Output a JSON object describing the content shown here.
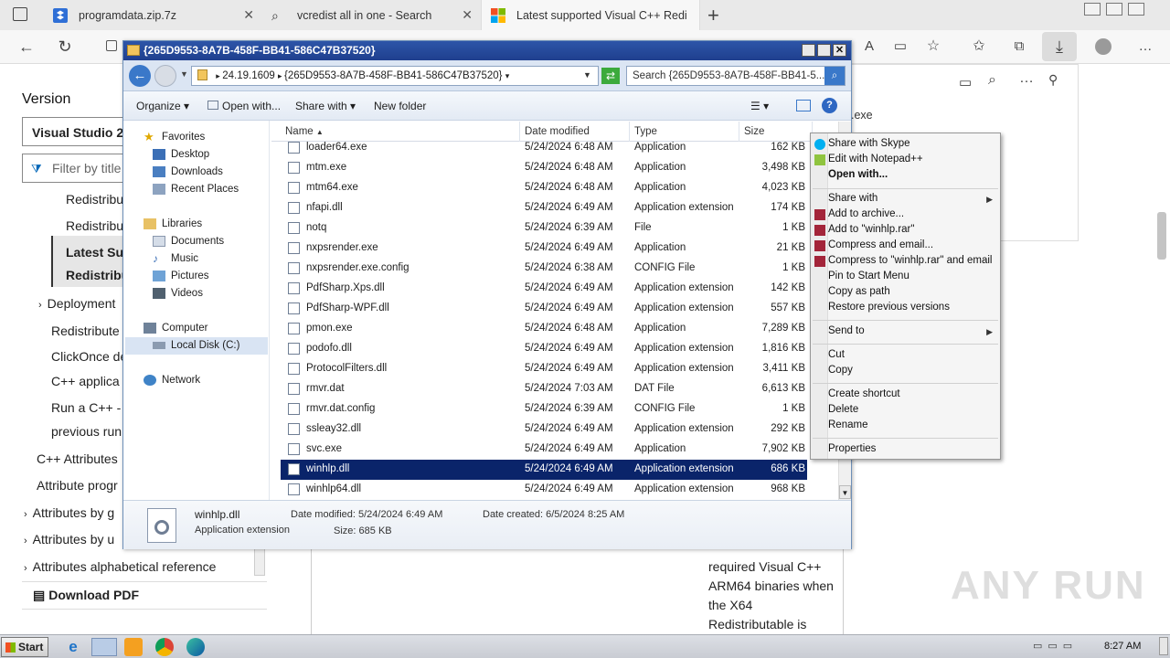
{
  "browser": {
    "tabs": [
      {
        "title": "programdata.zip.7z"
      },
      {
        "title": "vcredist all in one - Search"
      },
      {
        "title": "Latest supported Visual C++ Redi"
      }
    ],
    "new_tab": "+"
  },
  "doc": {
    "version_label": "Version",
    "version_select": "Visual Studio 20",
    "filter_placeholder": "Filter by title",
    "toc": [
      "Redistribu",
      "Redistribu",
      "Latest Sup",
      "Redistribu",
      "Deployment",
      "Redistribute",
      "ClickOnce de",
      "C++ applica",
      "Run a C++ -",
      "previous run",
      "C++ Attributes",
      "Attribute progr",
      "Attributes by g",
      "Attributes by u",
      "Attributes alphabetical reference"
    ],
    "download_pdf": "Download PDF",
    "content_snippet": ".exe",
    "content_lines": [
      "required Visual C++",
      "ARM64 binaries when",
      "the X64",
      "Redistributable is"
    ]
  },
  "explorer": {
    "title": "{265D9553-8A7B-458F-BB41-586C47B37520}",
    "breadcrumb": [
      "24.19.1609",
      "{265D9553-8A7B-458F-BB41-586C47B37520}"
    ],
    "search_placeholder": "Search {265D9553-8A7B-458F-BB41-5...",
    "toolbar": {
      "organize": "Organize",
      "open_with": "Open with...",
      "share_with": "Share with",
      "new_folder": "New folder"
    },
    "nav": {
      "favorites": "Favorites",
      "desktop": "Desktop",
      "downloads": "Downloads",
      "recent": "Recent Places",
      "libraries": "Libraries",
      "documents": "Documents",
      "music": "Music",
      "pictures": "Pictures",
      "videos": "Videos",
      "computer": "Computer",
      "local_disk": "Local Disk (C:)",
      "network": "Network"
    },
    "columns": [
      "Name",
      "Date modified",
      "Type",
      "Size"
    ],
    "files": [
      {
        "name": "loader64.exe",
        "date": "5/24/2024 6:48 AM",
        "type": "Application",
        "size": "162 KB"
      },
      {
        "name": "mtm.exe",
        "date": "5/24/2024 6:48 AM",
        "type": "Application",
        "size": "3,498 KB"
      },
      {
        "name": "mtm64.exe",
        "date": "5/24/2024 6:48 AM",
        "type": "Application",
        "size": "4,023 KB"
      },
      {
        "name": "nfapi.dll",
        "date": "5/24/2024 6:49 AM",
        "type": "Application extension",
        "size": "174 KB"
      },
      {
        "name": "notq",
        "date": "5/24/2024 6:39 AM",
        "type": "File",
        "size": "1 KB"
      },
      {
        "name": "nxpsrender.exe",
        "date": "5/24/2024 6:49 AM",
        "type": "Application",
        "size": "21 KB"
      },
      {
        "name": "nxpsrender.exe.config",
        "date": "5/24/2024 6:38 AM",
        "type": "CONFIG File",
        "size": "1 KB"
      },
      {
        "name": "PdfSharp.Xps.dll",
        "date": "5/24/2024 6:49 AM",
        "type": "Application extension",
        "size": "142 KB"
      },
      {
        "name": "PdfSharp-WPF.dll",
        "date": "5/24/2024 6:49 AM",
        "type": "Application extension",
        "size": "557 KB"
      },
      {
        "name": "pmon.exe",
        "date": "5/24/2024 6:48 AM",
        "type": "Application",
        "size": "7,289 KB"
      },
      {
        "name": "podofo.dll",
        "date": "5/24/2024 6:49 AM",
        "type": "Application extension",
        "size": "1,816 KB"
      },
      {
        "name": "ProtocolFilters.dll",
        "date": "5/24/2024 6:49 AM",
        "type": "Application extension",
        "size": "3,411 KB"
      },
      {
        "name": "rmvr.dat",
        "date": "5/24/2024 7:03 AM",
        "type": "DAT File",
        "size": "6,613 KB"
      },
      {
        "name": "rmvr.dat.config",
        "date": "5/24/2024 6:39 AM",
        "type": "CONFIG File",
        "size": "1 KB"
      },
      {
        "name": "ssleay32.dll",
        "date": "5/24/2024 6:49 AM",
        "type": "Application extension",
        "size": "292 KB"
      },
      {
        "name": "svc.exe",
        "date": "5/24/2024 6:49 AM",
        "type": "Application",
        "size": "7,902 KB"
      },
      {
        "name": "winhlp.dll",
        "date": "5/24/2024 6:49 AM",
        "type": "Application extension",
        "size": "686 KB"
      },
      {
        "name": "winhlp64.dll",
        "date": "5/24/2024 6:49 AM",
        "type": "Application extension",
        "size": "968 KB"
      }
    ],
    "selected_file": "winhlp.dll",
    "details": {
      "name": "winhlp.dll",
      "type": "Application extension",
      "modified_label": "Date modified:",
      "modified": "5/24/2024 6:49 AM",
      "created_label": "Date created:",
      "created": "6/5/2024 8:25 AM",
      "size_label": "Size:",
      "size": "685 KB"
    }
  },
  "context_menu": {
    "items": [
      "Share with Skype",
      "Edit with Notepad++",
      "Open with...",
      "Share with",
      "Add to archive...",
      "Add to \"winhlp.rar\"",
      "Compress and email...",
      "Compress to \"winhlp.rar\" and email",
      "Pin to Start Menu",
      "Copy as path",
      "Restore previous versions",
      "Send to",
      "Cut",
      "Copy",
      "Create shortcut",
      "Delete",
      "Rename",
      "Properties"
    ]
  },
  "taskbar": {
    "start": "Start",
    "clock": "8:27 AM"
  },
  "watermark": "ANY RUN",
  "colors": {
    "selection": "#0a246a",
    "title_bar": "#1f3f8e",
    "accent": "#0067b8"
  }
}
